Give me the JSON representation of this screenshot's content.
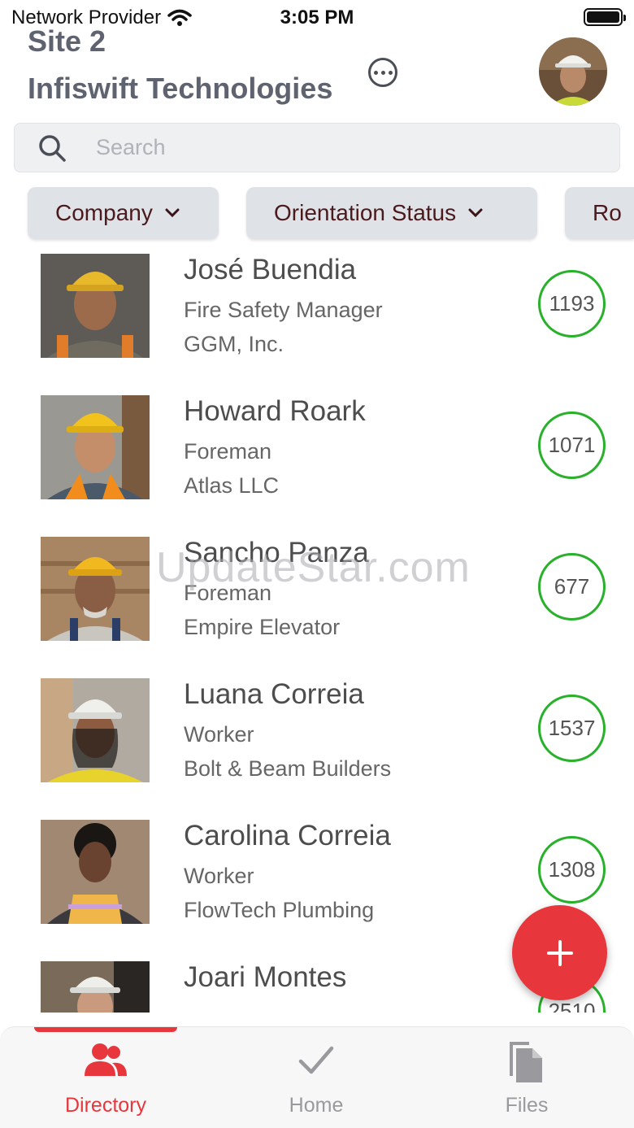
{
  "status_bar": {
    "carrier": "Network Provider",
    "time": "3:05 PM"
  },
  "header": {
    "site": "Site 2",
    "company": "Infiswift Technologies"
  },
  "search": {
    "placeholder": "Search"
  },
  "filters": [
    {
      "label": "Company"
    },
    {
      "label": "Orientation Status"
    },
    {
      "label": "Ro"
    }
  ],
  "people": [
    {
      "name": "José Buendia",
      "role": "Fire Safety Manager",
      "company": "GGM, Inc.",
      "score": "1193"
    },
    {
      "name": "Howard Roark",
      "role": "Foreman",
      "company": "Atlas LLC",
      "score": "1071"
    },
    {
      "name": "Sancho Panza",
      "role": "Foreman",
      "company": "Empire Elevator",
      "score": "677"
    },
    {
      "name": "Luana Correia",
      "role": "Worker",
      "company": "Bolt & Beam Builders",
      "score": "1537"
    },
    {
      "name": "Carolina Correia",
      "role": "Worker",
      "company": "FlowTech Plumbing",
      "score": "1308"
    },
    {
      "name": "Joari Montes",
      "role": "",
      "company": "",
      "score": "2510"
    }
  ],
  "watermark": "UpdateStar.com",
  "bottom_nav": {
    "items": [
      {
        "label": "Directory",
        "icon": "people-icon",
        "active": true
      },
      {
        "label": "Home",
        "icon": "checkmark-icon",
        "active": false
      },
      {
        "label": "Files",
        "icon": "files-icon",
        "active": false
      }
    ]
  },
  "colors": {
    "accent": "#e8363d",
    "badge_green": "#29b12b",
    "filter_text": "#4b1a1d"
  }
}
